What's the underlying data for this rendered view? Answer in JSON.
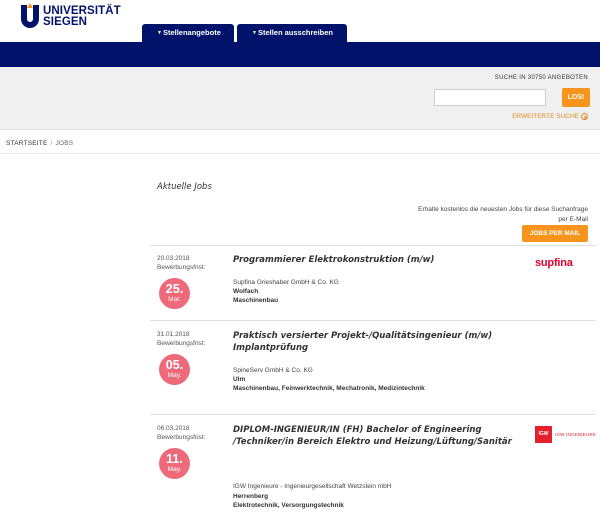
{
  "logo": {
    "line1": "UNIVERSITÄT",
    "line2": "SIEGEN"
  },
  "tabs": [
    {
      "label": "Stellenangebote"
    },
    {
      "label": "Stellen ausschreiben"
    }
  ],
  "search": {
    "title": "SUCHE IN 30750 ANGEBOTEN",
    "value": "",
    "button": "LOS!",
    "advanced": "ERWEITERTE SUCHE"
  },
  "breadcrumb": {
    "home": "STARTSEITE",
    "sep": "/",
    "current": "JOBS"
  },
  "section_title": "Aktuelle Jobs",
  "mail": {
    "text": "Erhalte kostenlos die neuesten Jobs für diese Suchanfrage per E-Mail",
    "button": "JOBS PER MAIL"
  },
  "frist_label": "Bewerbungsfrist:",
  "jobs": [
    {
      "date": "20.03.2018",
      "deadline_day": "25.",
      "deadline_month": "Mar.",
      "title": "Programmierer Elektrokonstruktion (m/w)",
      "company": "Supfina Grieshaber GmbH & Co. KG",
      "city": "Wolfach",
      "fields": "Maschinenbau",
      "logo": "supfina"
    },
    {
      "date": "31.01.2018",
      "deadline_day": "05.",
      "deadline_month": "May.",
      "title": "Praktisch versierter Projekt-/Qualitätsingenieur (m/w) Implantprüfung",
      "company": "SpineServ GmbH & Co. KG",
      "city": "Ulm",
      "fields": "Maschinenbau, Feinwerktechnik, Mechatronik, Medizintechnik",
      "logo": ""
    },
    {
      "date": "06.03.2018",
      "deadline_day": "11.",
      "deadline_month": "May.",
      "title": "DIPLOM-INGENIEUR/IN (FH) Bachelor of Engineering /Techniker/in Bereich Elektro und Heizung/Lüftung/Sanitär",
      "company": "IGW Ingenieure - Ingenieurgesellschaft Wetzstein mbH",
      "city": "Herrenberg",
      "fields": "Elektrotechnik, Versorgungstechnik",
      "logo": "IGW INGENIEURE"
    }
  ],
  "colors": {
    "navy": "#00126a",
    "orange": "#f7941d",
    "badge": "#ee6a7a"
  }
}
